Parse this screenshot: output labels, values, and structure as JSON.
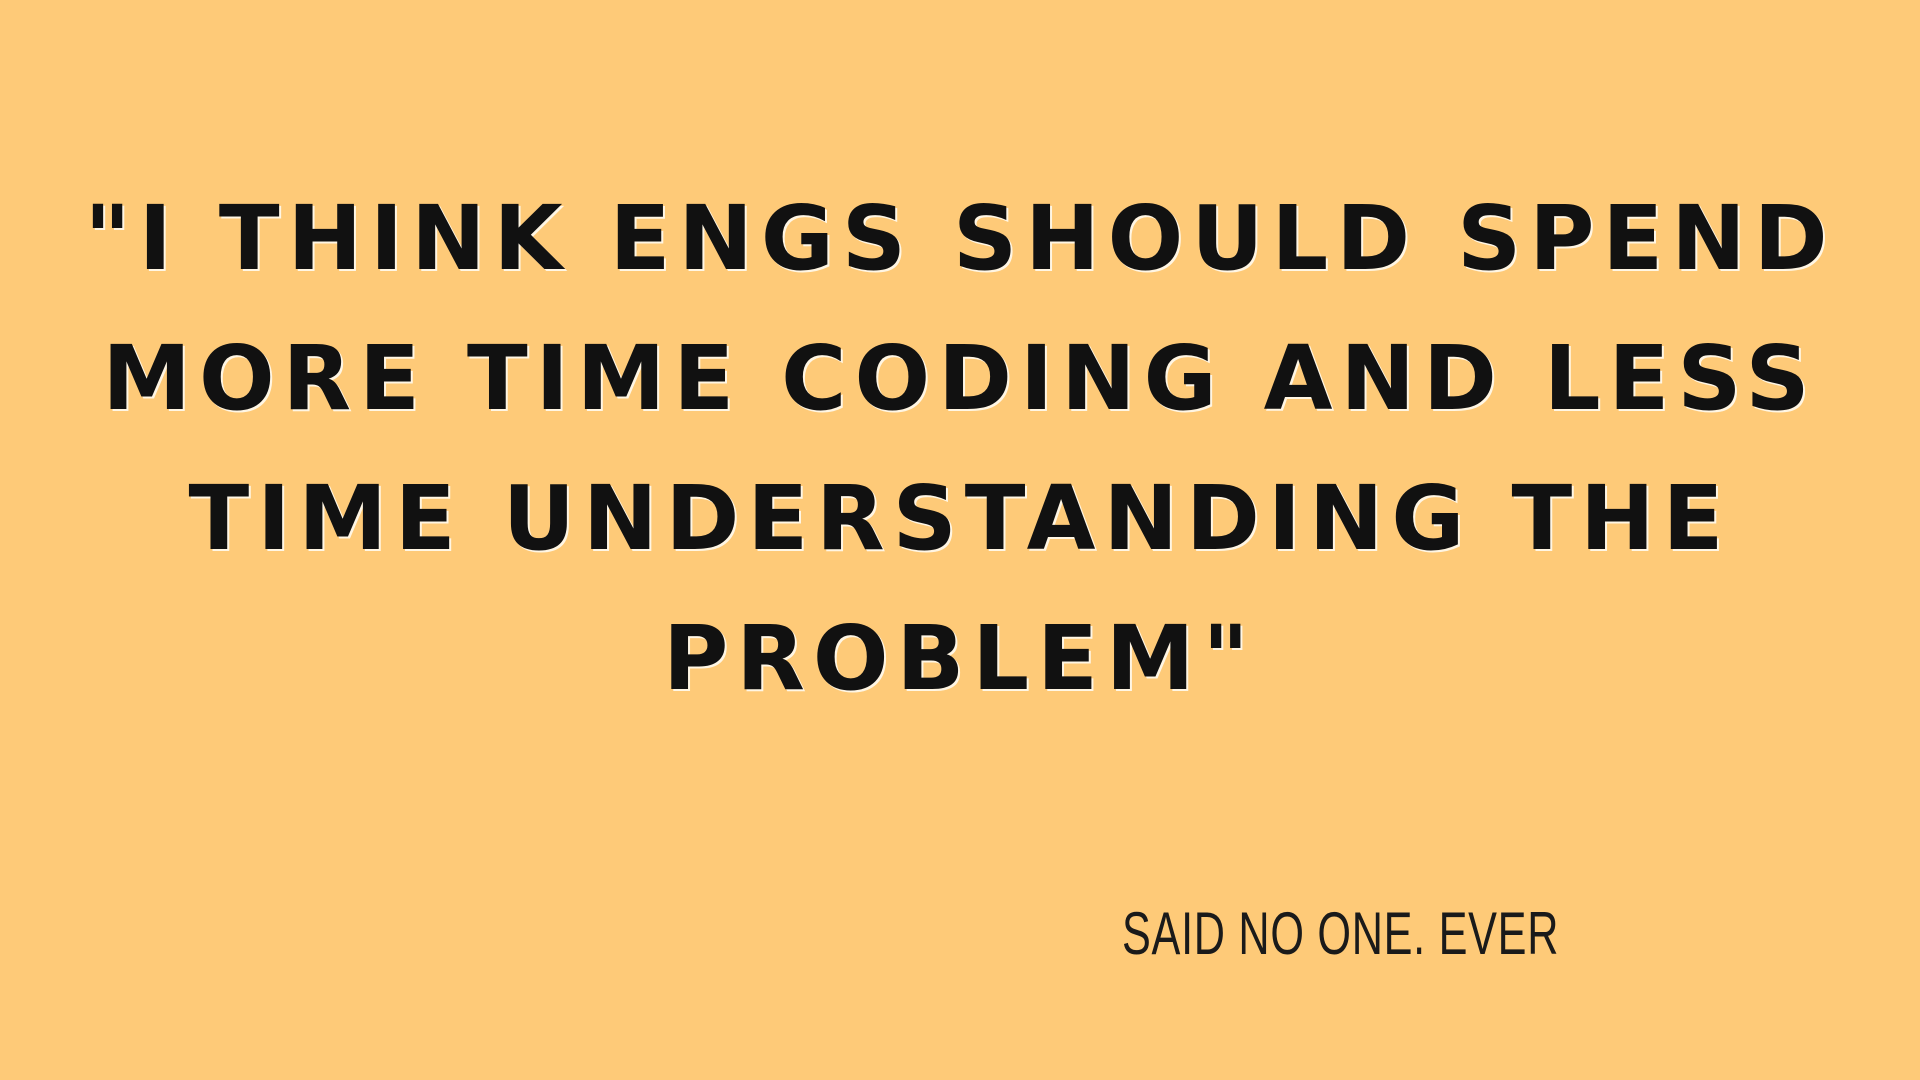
{
  "quote": {
    "lines": [
      "\"I THINK ENGS SHOULD SPEND",
      "MORE TIME CODING AND LESS",
      "TIME UNDERSTANDING THE",
      "PROBLEM\""
    ]
  },
  "attribution": "SAID NO ONE. EVER",
  "colors": {
    "background": "#FECA78",
    "text": "#111111"
  }
}
